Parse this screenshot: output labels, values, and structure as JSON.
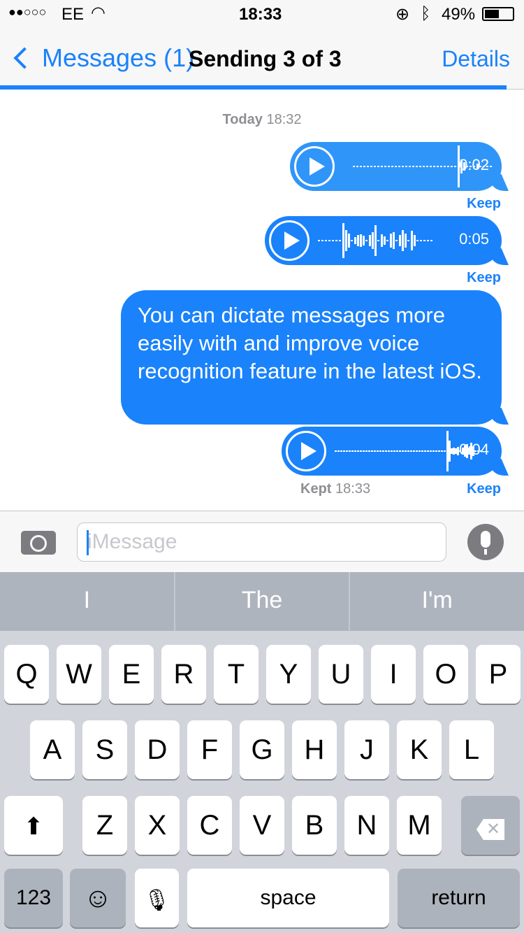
{
  "status": {
    "carrier": "EE",
    "signal_dots": "●●○○○",
    "time": "18:33",
    "battery": "49%",
    "battery_level": 0.49
  },
  "nav": {
    "back_label": "Messages (1)",
    "title": "Sending 3 of 3",
    "details_label": "Details",
    "send_progress": 0.97
  },
  "conversation": {
    "date_label": "Today",
    "date_time": "18:32",
    "messages": [
      {
        "type": "audio",
        "duration": "0:02",
        "action": "Keep"
      },
      {
        "type": "audio",
        "duration": "0:05",
        "action": "Keep"
      },
      {
        "type": "text",
        "text": "You can dictate messages more easily with and improve voice recognition feature in the latest iOS."
      },
      {
        "type": "audio",
        "duration": "0:04",
        "action": "Keep",
        "status_label": "Kept",
        "status_time": "18:33"
      }
    ]
  },
  "input": {
    "placeholder": "iMessage"
  },
  "suggestions": [
    "I",
    "The",
    "I'm"
  ],
  "keyboard": {
    "row1": [
      "Q",
      "W",
      "E",
      "R",
      "T",
      "Y",
      "U",
      "I",
      "O",
      "P"
    ],
    "row2": [
      "A",
      "S",
      "D",
      "F",
      "G",
      "H",
      "J",
      "K",
      "L"
    ],
    "row3": [
      "Z",
      "X",
      "C",
      "V",
      "B",
      "N",
      "M"
    ],
    "numbers": "123",
    "space": "space",
    "return": "return"
  },
  "colors": {
    "accent": "#1a82fb"
  }
}
